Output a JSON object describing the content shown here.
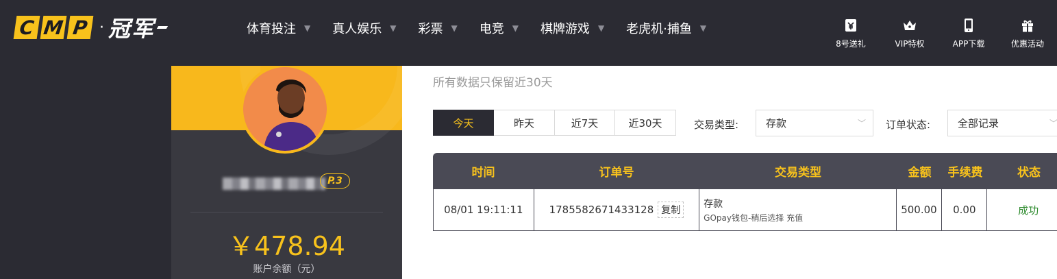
{
  "header": {
    "logo": {
      "letters": [
        "C",
        "M",
        "P"
      ],
      "dot": "·",
      "cn": "冠军"
    },
    "nav": [
      {
        "label": "体育投注"
      },
      {
        "label": "真人娱乐"
      },
      {
        "label": "彩票"
      },
      {
        "label": "电竞"
      },
      {
        "label": "棋牌游戏"
      },
      {
        "label": "老虎机·捕鱼"
      }
    ],
    "tools": [
      {
        "label": "8号送礼",
        "icon": "ticket-icon"
      },
      {
        "label": "VIP特权",
        "icon": "crown-icon"
      },
      {
        "label": "APP下载",
        "icon": "phone-icon"
      },
      {
        "label": "优惠活动",
        "icon": "gift-icon"
      }
    ]
  },
  "profile": {
    "vip_label": "VIP.3",
    "vip_badge_text": "P.3",
    "balance": "￥478.94",
    "balance_label": "账户余额（元）"
  },
  "main": {
    "note": "所有数据只保留近30天",
    "tabs": [
      {
        "label": "今天",
        "active": true
      },
      {
        "label": "昨天",
        "active": false
      },
      {
        "label": "近7天",
        "active": false
      },
      {
        "label": "近30天",
        "active": false
      }
    ],
    "filters": {
      "type_label": "交易类型:",
      "type_value": "存款",
      "status_label": "订单状态:",
      "status_value": "全部记录"
    },
    "table": {
      "headers": [
        "时间",
        "订单号",
        "交易类型",
        "金额",
        "手续费",
        "状态"
      ],
      "rows": [
        {
          "time": "08/01 19:11:11",
          "order_no": "1785582671433128",
          "copy_label": "复制",
          "type": "存款",
          "type_detail": "GOpay钱包-稍后选择 充值",
          "amount": "500.00",
          "fee": "0.00",
          "status": "成功"
        }
      ]
    }
  },
  "colors": {
    "accent": "#f8c21c",
    "dark": "#2b2b33",
    "success": "#2e8b2e"
  }
}
